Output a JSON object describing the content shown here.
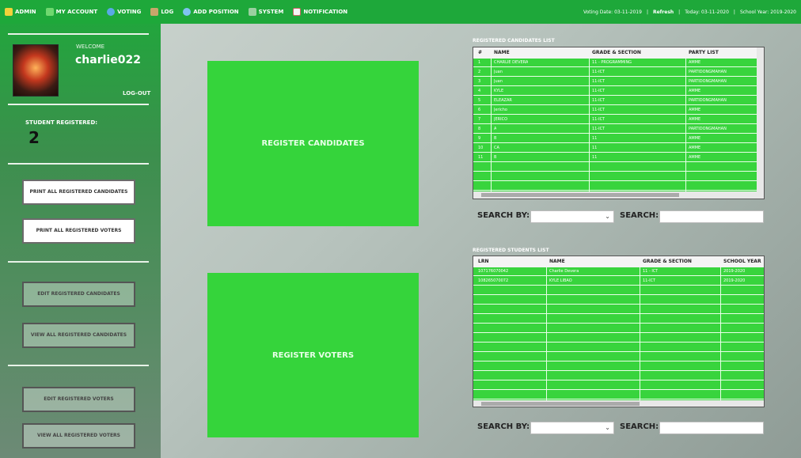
{
  "menu": {
    "admin": "ADMIN",
    "my_account": "MY ACCOUNT",
    "voting": "VOTING",
    "log": "LOG",
    "add_position": "ADD POSITION",
    "system": "SYSTEM",
    "notification": "NOTIFICATION",
    "voting_date": "Voting Date: 03-11-2019",
    "refresh": "Refresh",
    "today": "Today: 03-11-2020",
    "school_year": "School Year: 2019-2020"
  },
  "sidebar": {
    "welcome": "WELCOME",
    "username": "charlie022",
    "logout": "LOG-OUT",
    "student_registered_label": "STUDENT REGISTERED:",
    "student_registered_count": "2",
    "btn_print_candidates": "PRINT ALL REGISTERED CANDIDATES",
    "btn_print_voters": "PRINT ALL REGISTERED VOTERS",
    "btn_edit_candidates": "EDIT REGISTERED CANDIDATES",
    "btn_view_candidates": "VIEW ALL REGISTERED CANDIDATES",
    "btn_edit_voters": "EDIT REGISTERED VOTERS",
    "btn_view_voters": "VIEW ALL REGISTERED VOTERS"
  },
  "tiles": {
    "register_candidates": "REGISTER CANDIDATES",
    "register_voters": "REGISTER VOTERS"
  },
  "candidates": {
    "title": "REGISTERED CANDIDATES LIST",
    "headers": [
      "#",
      "NAME",
      "GRADE & SECTION",
      "PARTY LIST"
    ],
    "rows": [
      [
        "1",
        "CHARLIE DEVERA",
        "11 - PROGRAMMING",
        "AMME"
      ],
      [
        "2",
        "Juan",
        "11-ICT",
        "PARTIDONGMAHAN"
      ],
      [
        "3",
        "Juan",
        "11-ICT",
        "PARTIDONGMAHAN"
      ],
      [
        "4",
        "KYLE",
        "11-ICT",
        "AMME"
      ],
      [
        "5",
        "ELEAZAR",
        "11-ICT",
        "PARTIDONGMAHAN"
      ],
      [
        "6",
        "Jericho",
        "11-ICT",
        "AMME"
      ],
      [
        "7",
        "JERICO",
        "11-ICT",
        "AMME"
      ],
      [
        "8",
        "A",
        "11-ICT",
        "PARTIDONGMAHAN"
      ],
      [
        "9",
        "B",
        "11",
        "AMME"
      ],
      [
        "10",
        "CA",
        "11",
        "AMME"
      ],
      [
        "11",
        "B",
        "11",
        "AMME"
      ]
    ]
  },
  "students": {
    "title": "REGISTERED STUDENTS LIST",
    "headers": [
      "LRN",
      "NAME",
      "GRADE & SECTION",
      "SCHOOL YEAR"
    ],
    "rows": [
      [
        "107176070042",
        "Charlie Devera",
        "11 - ICT",
        "2019-2020"
      ],
      [
        "108265070072",
        "KYLE LIBAO",
        "11-ICT",
        "2019-2020"
      ]
    ]
  },
  "search": {
    "search_by_label": "SEARCH BY:",
    "search_label": "SEARCH:",
    "combo_arrow": "⌄"
  },
  "colors": {
    "menubar": "#1ea83a",
    "tile": "#35d43b",
    "grid": "#38d43d"
  }
}
